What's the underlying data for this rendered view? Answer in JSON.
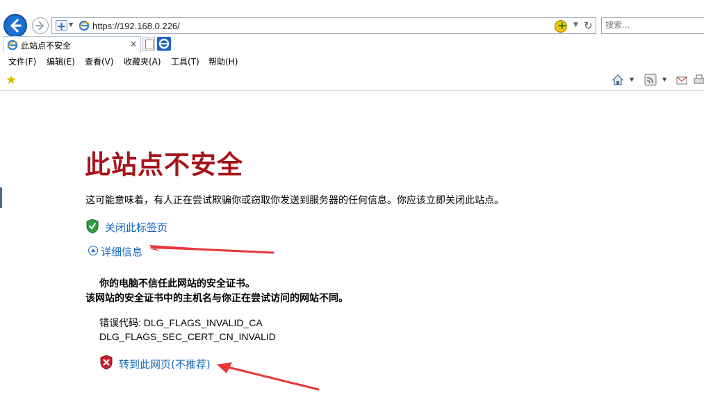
{
  "browser": {
    "url": "https://192.168.0.226/",
    "search_placeholder": "搜索...",
    "tab_title": "此站点不安全",
    "tab_close_glyph": "×",
    "menu": [
      "文件(F)",
      "编辑(E)",
      "查看(V)",
      "收藏夹(A)",
      "工具(T)",
      "帮助(H)"
    ],
    "accent": "#1c6fd0"
  },
  "page": {
    "title": "此站点不安全",
    "description": "这可能意味着，有人正在尝试欺骗你或窃取你发送到服务器的任何信息。你应该立即关闭此站点。",
    "close_tab_link": "关闭此标签页",
    "details_link": "详细信息",
    "detail_line1": "你的电脑不信任此网站的安全证书。",
    "detail_line2": "该网站的安全证书中的主机名与你正在尝试访问的网站不同。",
    "error_label": "错误代码: DLG_FLAGS_INVALID_CA",
    "error_code2": "DLG_FLAGS_SEC_CERT_CN_INVALID",
    "goto_link": "转到此网页(不推荐)",
    "title_color": "#a4151a",
    "link_color": "#1565c0"
  },
  "annotations": {
    "arrow_color": "#e8363a"
  }
}
